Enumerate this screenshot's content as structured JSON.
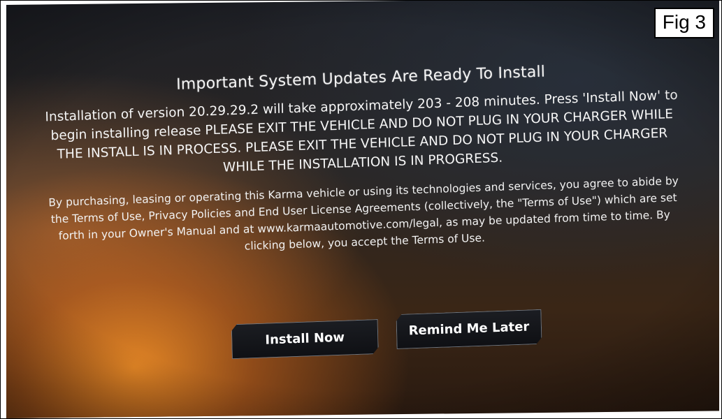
{
  "figure_label": "Fig 3",
  "dialog": {
    "title": "Important System Updates Are Ready To Install",
    "body": "Installation of version 20.29.29.2 will take approximately 203 - 208 minutes. Press 'Install Now' to begin installing release PLEASE EXIT THE VEHICLE AND DO NOT PLUG IN YOUR CHARGER WHILE THE INSTALL IS IN PROCESS. PLEASE EXIT THE VEHICLE AND DO NOT PLUG IN YOUR CHARGER WHILE THE INSTALLATION IS IN PROGRESS.",
    "terms": "By purchasing, leasing or operating this Karma vehicle or using its technologies and services, you agree to abide by the Terms of Use, Privacy Policies and End User License Agreements (collectively, the \"Terms of Use\") which are set forth in your Owner's Manual and at www.karmaautomotive.com/legal, as may be updated from time to time.  By clicking below, you accept the Terms of Use.",
    "buttons": {
      "install_label": "Install Now",
      "remind_label": "Remind Me Later"
    }
  },
  "colors": {
    "text": "#ffffff",
    "button_bg": "#111317",
    "button_border": "#6c7580",
    "accent_glow": "#ff9628"
  }
}
